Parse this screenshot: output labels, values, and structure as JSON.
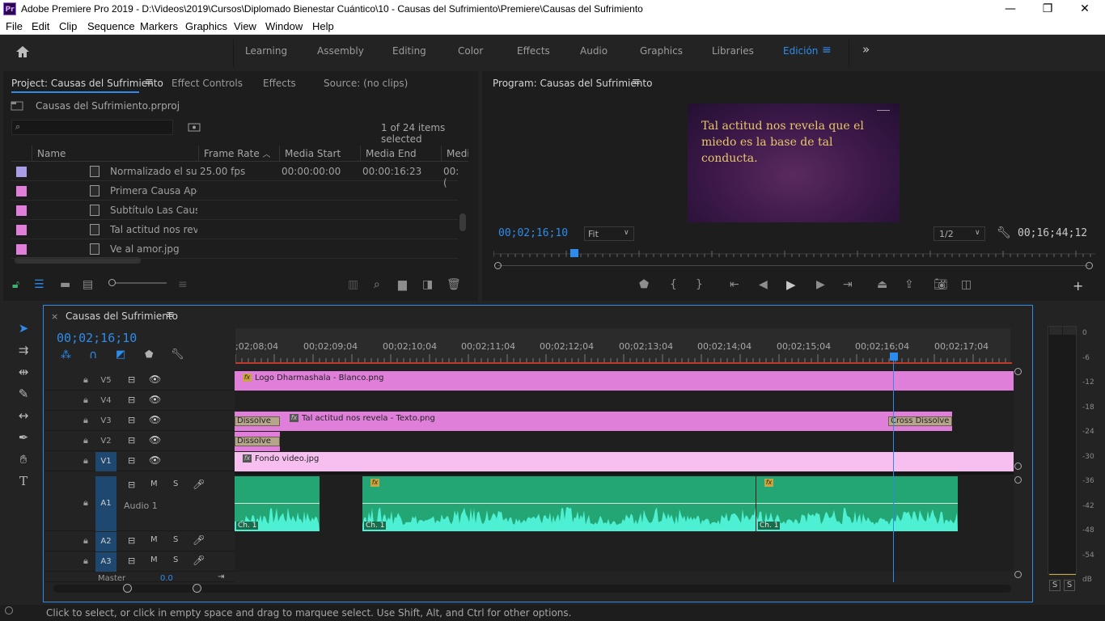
{
  "window": {
    "app_badge": "Pr",
    "title": "Adobe Premiere Pro 2019 - D:\\Videos\\2019\\Cursos\\Diplomado Bienestar Cuántico\\10 - Causas del Sufrimiento\\Premiere\\Causas del Sufrimiento",
    "minimize": "—",
    "restore": "❐",
    "close": "✕"
  },
  "menu": [
    "File",
    "Edit",
    "Clip",
    "Sequence",
    "Markers",
    "Graphics",
    "View",
    "Window",
    "Help"
  ],
  "workspaces": {
    "items": [
      "Learning",
      "Assembly",
      "Editing",
      "Color",
      "Effects",
      "Audio",
      "Graphics",
      "Libraries",
      "Edición"
    ],
    "active": "Edición",
    "accent": "#2d8ceb"
  },
  "project": {
    "tabs": [
      "Project: Causas del Sufrimiento",
      "Effect Controls",
      "Effects",
      "Source: (no clips)"
    ],
    "file": "Causas del Sufrimiento.prproj",
    "search_placeholder": "",
    "count": "1 of 24 items selected",
    "columns": [
      "Name",
      "Frame Rate",
      "Media Start",
      "Media End",
      "Media"
    ],
    "rows": [
      {
        "color": "#a99de6",
        "name": "Normalizado el suf",
        "frame_rate": "25.00 fps",
        "media_start": "00:00:00:00",
        "media_end": "00:00:16:23",
        "media": "00:("
      },
      {
        "color": "#e07fd9",
        "name": "Primera Causa Ape",
        "frame_rate": "",
        "media_start": "",
        "media_end": "",
        "media": ""
      },
      {
        "color": "#e07fd9",
        "name": "Subtítulo Las Causa",
        "frame_rate": "",
        "media_start": "",
        "media_end": "",
        "media": ""
      },
      {
        "color": "#e07fd9",
        "name": "Tal actitud nos rev",
        "frame_rate": "",
        "media_start": "",
        "media_end": "",
        "media": ""
      },
      {
        "color": "#e07fd9",
        "name": "Ve al amor.jpg",
        "frame_rate": "",
        "media_start": "",
        "media_end": "",
        "media": ""
      }
    ]
  },
  "program": {
    "title": "Program: Causas del Sufrimiento",
    "video_text": "Tal actitud nos revela que el miedo es la base de tal conducta.",
    "current_time": "00;02;16;10",
    "fit": "Fit",
    "resolution": "1/2",
    "duration": "00;16;44;12",
    "playhead_fraction": 0.135
  },
  "sequence": {
    "name": "Causas del Sufrimiento",
    "timecode": "00;02;16;10",
    "ruler": [
      ";02;08;04",
      "00;02;09;04",
      "00;02;10;04",
      "00;02;11;04",
      "00;02;12;04",
      "00;02;13;04",
      "00;02;14;04",
      "00;02;15;04",
      "00;02;16;04",
      "00;02;17;04"
    ],
    "video_tracks": [
      "V5",
      "V4",
      "V3",
      "V2",
      "V1"
    ],
    "audio_tracks": [
      "A1",
      "A2",
      "A3"
    ],
    "audio1_name": "Audio 1",
    "master_label": "Master",
    "master_value": "0.0",
    "mute": "M",
    "solo": "S",
    "clips": {
      "v5": "Logo Dharmashala - Blanco.png",
      "v3": "Tal actitud nos revela - Texto.png",
      "v1": "Fondo video.jpg",
      "dissolve": "Dissolve",
      "cross_dissolve": "Cross Dissolve",
      "channel": "Ch. 1",
      "fx": "fx"
    }
  },
  "meter": {
    "labels": [
      "0",
      "-6",
      "-12",
      "-18",
      "-24",
      "-30",
      "-36",
      "-42",
      "-48",
      "-54",
      "dB"
    ],
    "solo": [
      "S",
      "S"
    ]
  },
  "status": "Click to select, or click in empty space and drag to marquee select. Use Shift, Alt, and Ctrl for other options."
}
